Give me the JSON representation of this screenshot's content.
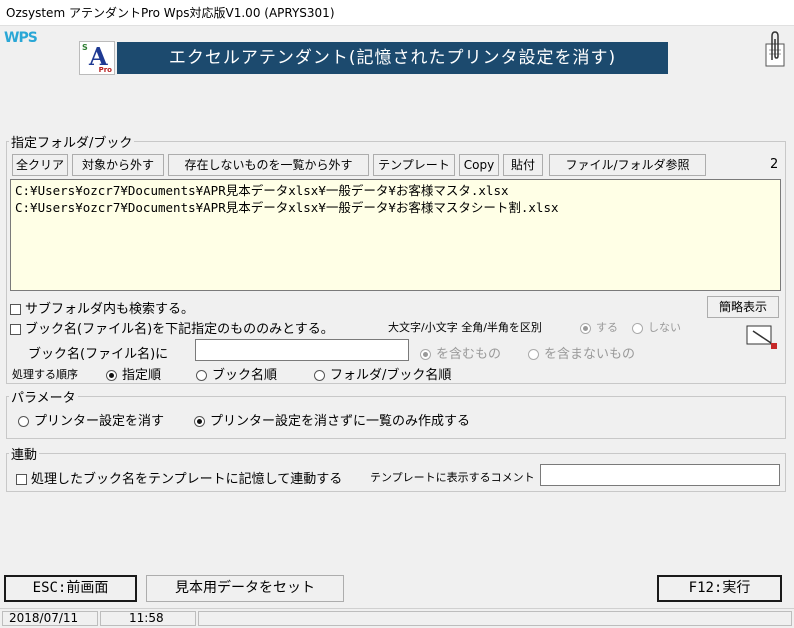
{
  "window": {
    "title": "Ozsystem アテンダントPro Wps対応版V1.00 (APRYS301)"
  },
  "header": {
    "wps_label": "WPS",
    "logo": {
      "s": "S",
      "a": "A",
      "pro": "Pro"
    },
    "banner": "エクセルアテンダント(記憶されたプリンタ設定を消す)"
  },
  "folder_section": {
    "legend": "指定フォルダ/ブック",
    "buttons": {
      "clear_all": "全クリア",
      "exclude": "対象から外す",
      "remove_missing": "存在しないものを一覧から外す",
      "template": "テンプレート",
      "copy": "Copy",
      "paste": "貼付",
      "browse": "ファイル/フォルダ参照"
    },
    "count": "2",
    "paths": [
      "C:¥Users¥ozcr7¥Documents¥APR見本データxlsx¥一般データ¥お客様マスタ.xlsx",
      "C:¥Users¥ozcr7¥Documents¥APR見本データxlsx¥一般データ¥お客様マスタシート割.xlsx"
    ],
    "subfolder_label": "サブフォルダ内も検索する。",
    "simple_view_button": "簡略表示",
    "name_filter_label": "ブック名(ファイル名)を下記指定のもののみとする。",
    "case_label": "大文字/小文字 全角/半角を区別",
    "case_yes": "する",
    "case_no": "しない",
    "book_name_label": "ブック名(ファイル名)に",
    "book_name_value": "",
    "contains": "を含むもの",
    "not_contains": "を含まないもの",
    "order_label": "処理する順序",
    "order_options": [
      "指定順",
      "ブック名順",
      "フォルダ/ブック名順"
    ]
  },
  "params": {
    "legend": "パラメータ",
    "option1": "プリンター設定を消す",
    "option2": "プリンター設定を消さずに一覧のみ作成する"
  },
  "link": {
    "legend": "連動",
    "checkbox_label": "処理したブック名をテンプレートに記憶して連動する",
    "comment_label": "テンプレートに表示するコメント",
    "comment_value": ""
  },
  "footer": {
    "esc_button": "ESC:前画面",
    "sample_button": "見本用データをセット",
    "f12_button": "F12:実行"
  },
  "status": {
    "date": "2018/07/11",
    "time": "11:58"
  },
  "colors": {
    "banner": "#1c4a6e",
    "list_bg": "#ffffe6",
    "wps": "#2aa7d6"
  }
}
